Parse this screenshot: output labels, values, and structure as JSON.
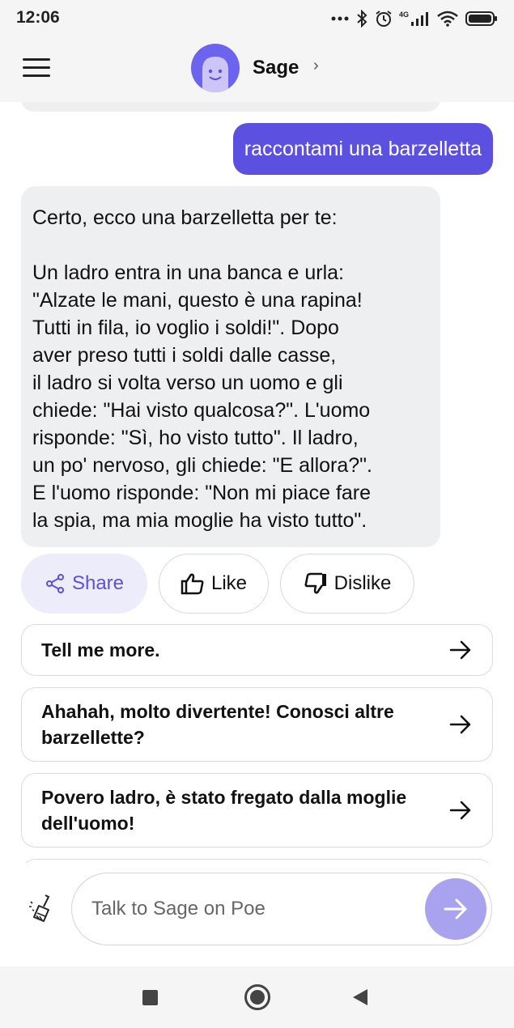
{
  "status_bar": {
    "time": "12:06",
    "network": "4G",
    "icons": [
      "more-dots-icon",
      "bluetooth-icon",
      "alarm-icon",
      "cellular-signal-icon",
      "wifi-icon",
      "battery-icon"
    ]
  },
  "header": {
    "bot_name": "Sage",
    "chevron": "›",
    "menu_icon": "hamburger-menu-icon",
    "avatar_color": "#6c63ef"
  },
  "chat": {
    "user_message": "raccontami una barzelletta",
    "bot_message": "Certo, ecco una barzelletta per te:\n\nUn ladro entra in una banca e urla:\n\"Alzate le mani, questo è una rapina!\nTutti in fila, io voglio i soldi!\". Dopo\naver preso tutti i soldi dalle casse,\nil ladro si volta verso un uomo e gli\nchiede: \"Hai visto qualcosa?\". L'uomo\nrisponde: \"Sì, ho visto tutto\". Il ladro,\nun po' nervoso, gli chiede: \"E allora?\".\nE l'uomo risponde: \"Non mi piace fare\nla spia, ma mia moglie ha visto tutto\".",
    "user_bubble_color": "#5b50e0",
    "bot_bubble_color": "#eeeff1"
  },
  "actions": {
    "share_label": "Share",
    "like_label": "Like",
    "dislike_label": "Dislike"
  },
  "suggestions": [
    "Tell me more.",
    "Ahahah, molto divertente! Conosci altre barzellette?",
    "Povero ladro, è stato fregato dalla moglie dell'uomo!"
  ],
  "composer": {
    "placeholder": "Talk to Sage on Poe",
    "value": "",
    "send_button_color": "#a8a2ef"
  },
  "nav_bar": {
    "buttons": [
      "recents-square-icon",
      "home-circle-icon",
      "back-triangle-icon"
    ]
  }
}
